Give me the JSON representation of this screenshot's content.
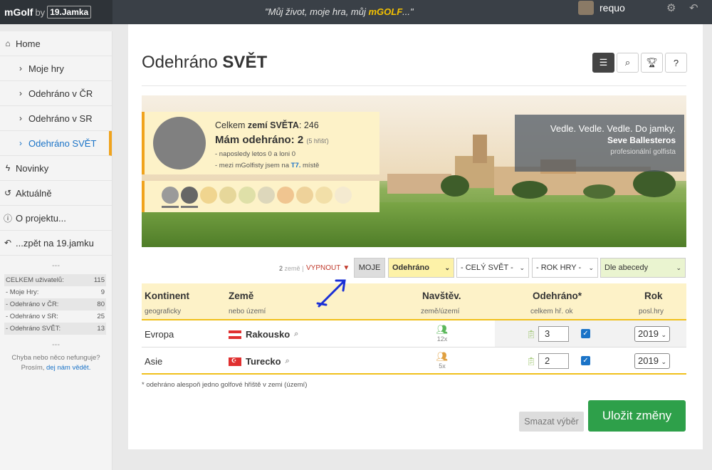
{
  "topbar": {
    "logo_m": "mGolf",
    "logo_by": "by",
    "logo_jamka": "19.Jamka",
    "motto_pre": "\"Můj život, moje hra, můj ",
    "motto_brand": "mGOLF",
    "motto_post": "...\"",
    "username": "requo"
  },
  "sidebar": {
    "items": [
      {
        "label": "Home",
        "icon": "home-icon"
      },
      {
        "label": "Moje hry",
        "icon": "chevron-right-icon"
      },
      {
        "label": "Odehráno v ČR",
        "icon": "chevron-right-icon"
      },
      {
        "label": "Odehráno v SR",
        "icon": "chevron-right-icon"
      },
      {
        "label": "Odehráno SVĚT",
        "icon": "chevron-right-icon"
      },
      {
        "label": "Novinky",
        "icon": "bolt-icon"
      },
      {
        "label": "Aktuálně",
        "icon": "history-icon"
      },
      {
        "label": "O projektu...",
        "icon": "info-icon"
      },
      {
        "label": "...zpět na 19.jamku",
        "icon": "reply-icon"
      }
    ],
    "dots": "---",
    "stats": [
      {
        "label": "CELKEM uživatelů:",
        "value": "115"
      },
      {
        "label": "- Moje Hry:",
        "value": "9"
      },
      {
        "label": "- Odehráno v ČR:",
        "value": "80"
      },
      {
        "label": "- Odehráno v SR:",
        "value": "25"
      },
      {
        "label": "- Odehráno SVĚT:",
        "value": "13"
      }
    ],
    "dots2": "---",
    "error_line1": "Chyba nebo něco nefunguje?",
    "error_line2": "Prosím,",
    "error_link": "dej nám vědět."
  },
  "page": {
    "title_pre": "Odehráno",
    "title_bold": "SVĚT"
  },
  "infobox": {
    "total_pre": "Celkem",
    "total_bold": "zemí SVĚTA",
    "total_val": ": 246",
    "played": "Mám odehráno: 2",
    "played_small": "(5 hřišť)",
    "recent": "- naposledy letos 0 a loni 0",
    "rank_pre": "- mezi mGolfisty jsem na",
    "rank": "T7.",
    "rank_post": "místě"
  },
  "quote": {
    "text": "Vedle. Vedle. Vedle. Do jamky.",
    "author": "Seve Ballesteros",
    "role": "profesionální golfista"
  },
  "filters": {
    "count": "2",
    "count_unit": "země",
    "off_label": "VYPNOUT",
    "moje": "MOJE",
    "sel1": "Odehráno",
    "sel2": "- CELÝ SVĚT -",
    "sel3": "- ROK HRY -",
    "sel4": "Dle abecedy"
  },
  "table": {
    "headers": [
      {
        "title": "Kontinent",
        "sub": "geograficky"
      },
      {
        "title": "Země",
        "sub": "nebo území"
      },
      {
        "title": "Navštěv.",
        "sub": "země/území"
      },
      {
        "title": "Odehráno*",
        "sub": "celkem hř.   ok"
      },
      {
        "title": "Rok",
        "sub": "posl.hry"
      }
    ],
    "rows": [
      {
        "continent": "Evropa",
        "country": "Rakousko",
        "visits": "12x",
        "played": "3",
        "year": "2019"
      },
      {
        "continent": "Asie",
        "country": "Turecko",
        "visits": "5x",
        "played": "2",
        "year": "2019"
      }
    ]
  },
  "note": "* odehráno alespoň jedno golfové hřiště v zemi (území)",
  "buttons": {
    "clear": "Smazat výběr",
    "save": "Uložit změny"
  }
}
